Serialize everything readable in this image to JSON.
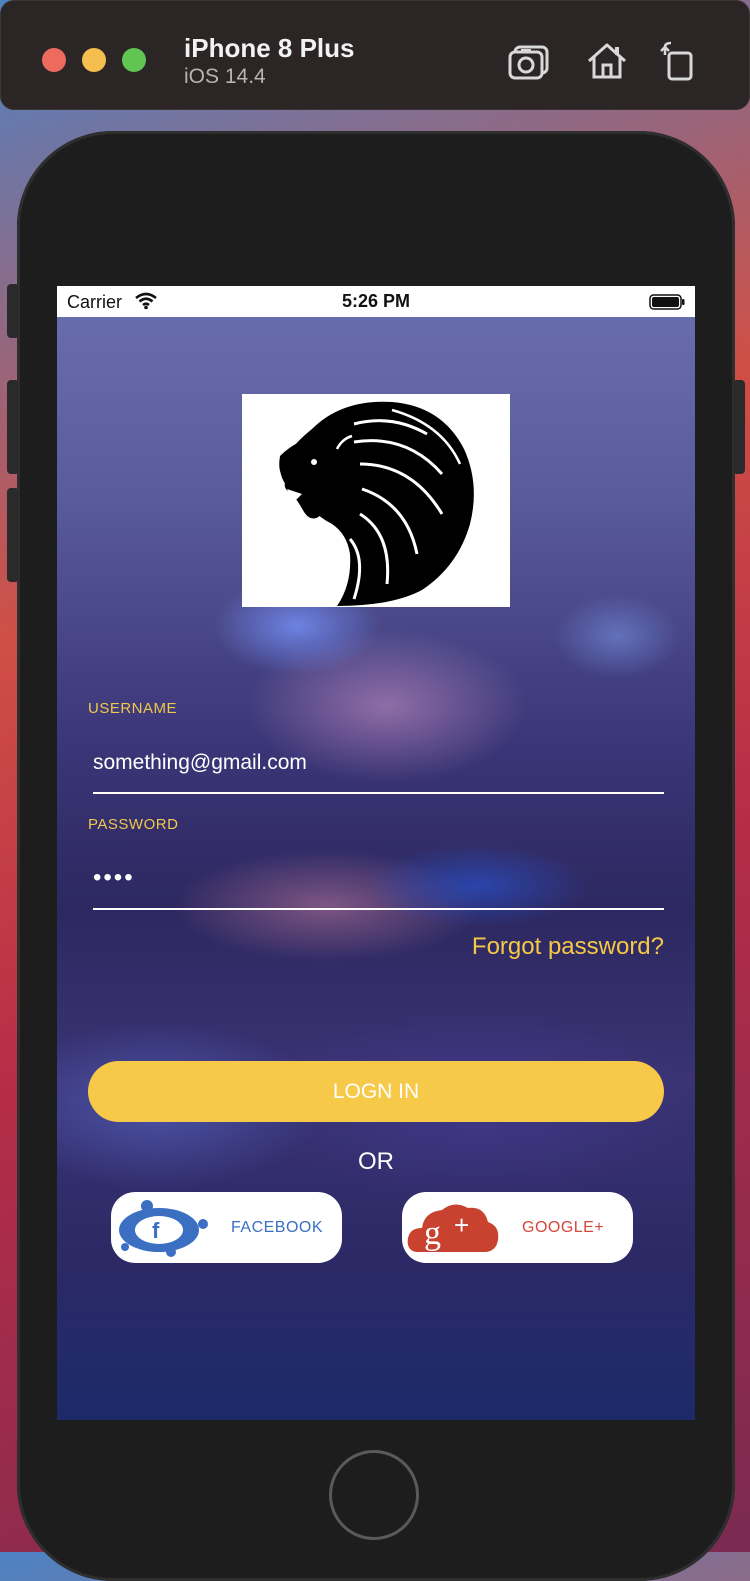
{
  "simulator": {
    "device_name": "iPhone 8 Plus",
    "os_version": "iOS 14.4",
    "toolbar_icons": [
      "screenshot-icon",
      "home-icon",
      "rotate-icon"
    ]
  },
  "status_bar": {
    "carrier": "Carrier",
    "time": "5:26 PM"
  },
  "login_form": {
    "username_label": "USERNAME",
    "username_value": "something@gmail.com",
    "password_label": "PASSWORD",
    "password_value": "••••",
    "forgot_password": "Forgot password?",
    "login_button": "LOGN IN",
    "or_text": "OR"
  },
  "social": {
    "facebook_label": "FACEBOOK",
    "google_label": "GOOGLE+"
  },
  "colors": {
    "accent_yellow": "#f7c948",
    "facebook_blue": "#3a6fc2",
    "google_red": "#d4483b"
  }
}
